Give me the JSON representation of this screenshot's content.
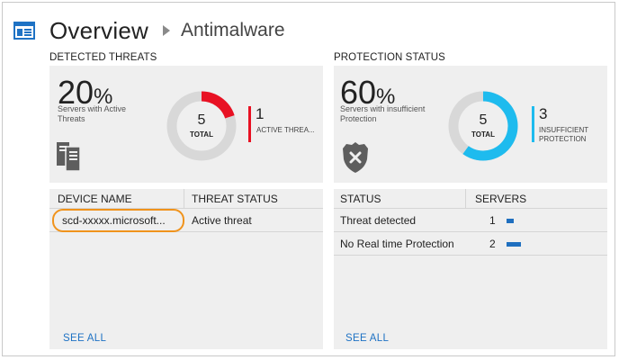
{
  "header": {
    "title": "Overview",
    "subtitle": "Antimalware"
  },
  "detected_threats": {
    "section_title": "DETECTED THREATS",
    "percent": "20",
    "percent_symbol": "%",
    "percent_desc": "Servers with Active Threats",
    "donut_total": "5",
    "donut_total_label": "TOTAL",
    "donut_fraction": 0.2,
    "count": "1",
    "count_label": "ACTIVE THREA...",
    "accent_color": "#e81123",
    "table": {
      "headers": [
        "DEVICE NAME",
        "THREAT STATUS"
      ],
      "rows": [
        {
          "device": "scd-xxxxx.microsoft...",
          "status": "Active threat"
        }
      ]
    },
    "see_all": "SEE ALL"
  },
  "protection_status": {
    "section_title": "PROTECTION STATUS",
    "percent": "60",
    "percent_symbol": "%",
    "percent_desc": "Servers with insufficient Protection",
    "donut_total": "5",
    "donut_total_label": "TOTAL",
    "donut_fraction": 0.6,
    "count": "3",
    "count_label": "INSUFFICIENT PROTECTION",
    "accent_color": "#1ebbee",
    "table": {
      "headers": [
        "STATUS",
        "SERVERS"
      ],
      "rows": [
        {
          "status": "Threat detected",
          "servers": "1",
          "fraction": 0.5
        },
        {
          "status": "No Real time Protection",
          "servers": "2",
          "fraction": 1.0
        }
      ]
    },
    "see_all": "SEE ALL"
  },
  "icons": {
    "header": "overview-icon",
    "threat_tile": "server-icon",
    "protection_tile": "shield-x-icon"
  }
}
